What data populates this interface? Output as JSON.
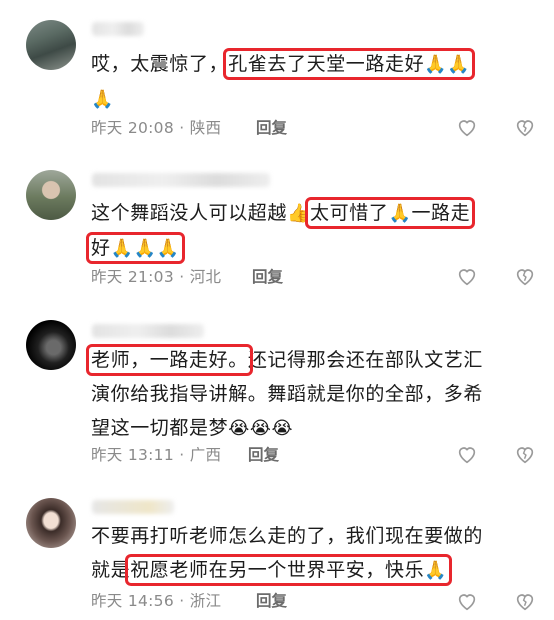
{
  "comments": [
    {
      "pre": "哎，太震惊了，",
      "hl": "孔雀去了天堂一路走好",
      "emoji_a": "🙏🙏",
      "emoji_b": "🙏",
      "time": "昨天 20:08",
      "location": "陕西",
      "reply": "回复"
    },
    {
      "pre": "这个舞蹈没人可以超越",
      "thumb": "👍",
      "hl1": "太可惜了",
      "hl1_emoji": "🙏",
      "hl1_post": "一路走",
      "hl2_pre": "好",
      "hl2_emoji": "🙏🙏🙏",
      "time": "昨天 21:03",
      "location": "河北",
      "reply": "回复"
    },
    {
      "hl": "老师，一路走好。",
      "line1_rest": "还记得那会还在部队文艺汇",
      "line2": "演你给我指导讲解。舞蹈就是你的全部，多希",
      "line3": "望这一切都是梦",
      "emoji": "😭😭😭",
      "time": "昨天 13:11",
      "location": "广西",
      "reply": "回复"
    },
    {
      "line1": "不要再打听老师怎么走的了，我们现在要做的",
      "pre2": "就是",
      "hl": "祝愿老师在另一个世界平安，快乐",
      "hl_emoji": "🙏",
      "time": "昨天 14:56",
      "location": "浙江",
      "reply": "回复"
    }
  ],
  "separator": " · ",
  "icons": [
    "heart-outline-icon",
    "broken-heart-icon"
  ]
}
